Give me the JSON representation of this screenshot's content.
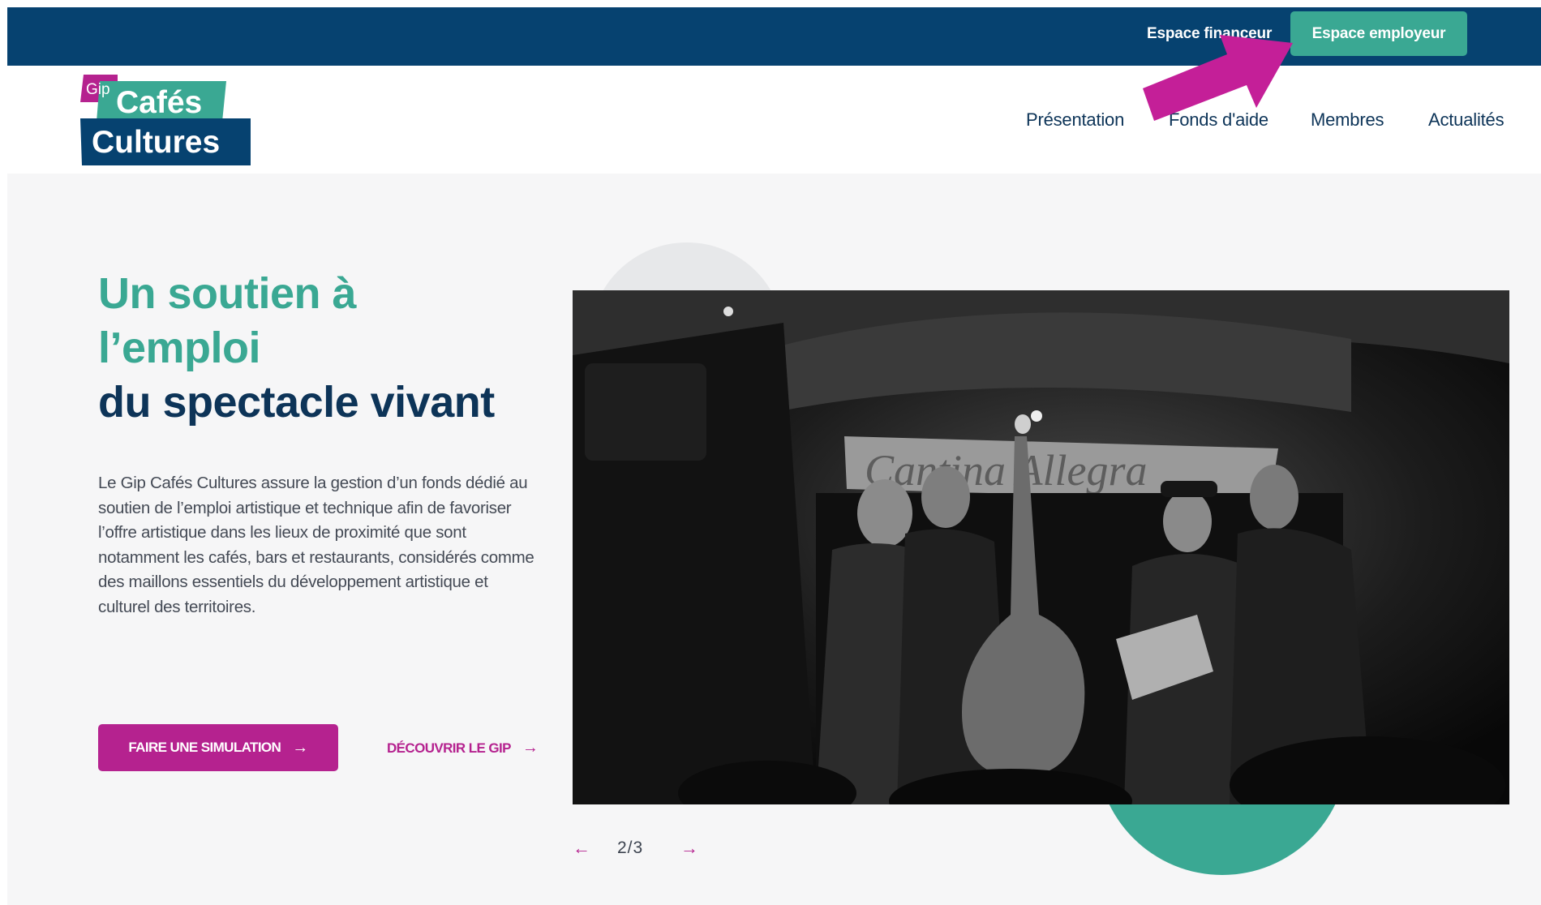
{
  "topbar": {
    "financeur_label": "Espace financeur",
    "employeur_label": "Espace employeur"
  },
  "logo": {
    "tag": "Gip",
    "line1": "Cafés",
    "line2": "Cultures"
  },
  "nav": {
    "items": [
      "Présentation",
      "Fonds d'aide",
      "Membres",
      "Actualités"
    ]
  },
  "hero": {
    "title_line1": "Un soutien à",
    "title_line2": "l’emploi",
    "title_line3": "du spectacle vivant",
    "paragraph": "Le Gip Cafés Cultures assure la gestion d’un fonds dédié au soutien de l’emploi artistique et technique afin de favoriser l’offre artistique dans les lieux de proximité que sont notamment les cafés, bars et restaurants, considérés comme des maillons essentiels du développement artistique et culturel des territoires.",
    "cta_primary": "FAIRE UNE SIMULATION",
    "cta_secondary": "DÉCOUVRIR LE GIP",
    "arrow": "→",
    "image_sign": "Cantina Allegra"
  },
  "slider": {
    "current": "2/3",
    "prev": "←",
    "next": "→"
  },
  "colors": {
    "navy": "#064270",
    "teal": "#3aa893",
    "magenta": "#b5228f",
    "title_navy": "#0d3458"
  },
  "icons": {
    "cta_arrow": "arrow-right-icon",
    "prev": "arrow-left-icon",
    "next": "arrow-right-icon",
    "annotation": "pointer-arrow-icon"
  }
}
